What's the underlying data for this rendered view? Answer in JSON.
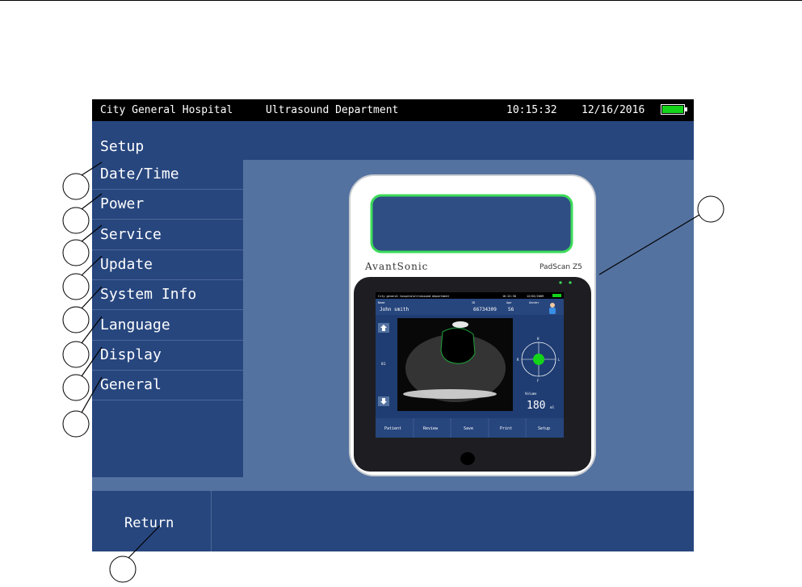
{
  "status_bar": {
    "hospital": "City General Hospital",
    "department": "Ultrasound Department",
    "time": "10:15:32",
    "date": "12/16/2016",
    "battery_level": 1.0,
    "battery_color": "#14d41a"
  },
  "title": "Setup",
  "menu": {
    "items": [
      {
        "label": "Date/Time"
      },
      {
        "label": "Power"
      },
      {
        "label": "Service"
      },
      {
        "label": "Update"
      },
      {
        "label": "System Info"
      },
      {
        "label": "Language"
      },
      {
        "label": "Display"
      },
      {
        "label": "General"
      }
    ]
  },
  "footer": {
    "return_label": "Return"
  },
  "device": {
    "brand": "AvantSonic",
    "model": "PadScan Z5",
    "mini_screen": {
      "hospital": "City general hospital",
      "department": "ultrasound department",
      "time": "16:22:38",
      "date": "12/02/2009",
      "name_label": "Name",
      "name": "John smith",
      "id_label": "ID",
      "id": "66734309",
      "age_label": "Age",
      "age": "56",
      "gender_label": "Gender",
      "frame": "01",
      "volume_label": "Volume",
      "volume": "180",
      "volume_unit": "ml",
      "orient_top": "H",
      "orient_left": "R",
      "orient_right": "L",
      "orient_bottom": "F",
      "buttons": [
        "Patient",
        "Review",
        "Save",
        "Print",
        "Setup"
      ]
    }
  },
  "colors": {
    "screen_bg": "#5472a0",
    "panel_bg": "#27467e",
    "status_bg": "#000000",
    "accent_green": "#14d41a"
  }
}
